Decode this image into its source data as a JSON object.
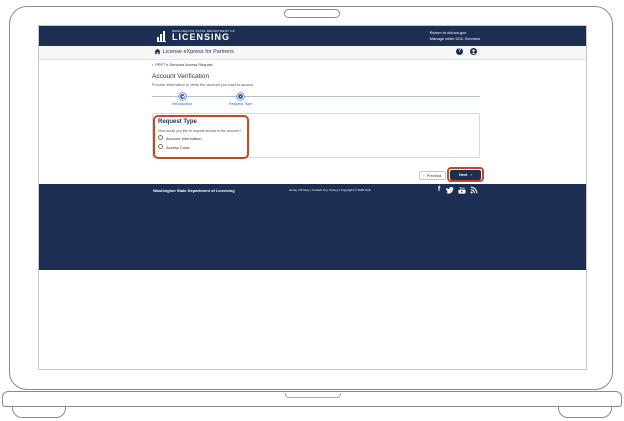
{
  "header": {
    "logo_small": "WASHINGTON STATE DEPARTMENT OF",
    "logo_big": "LICENSING",
    "link_return": "Return to dol.wa.gov",
    "link_manage": "Manage other DOL Services"
  },
  "subnav": {
    "app_title": "License eXpress for Partners",
    "home_icon": "home-icon",
    "help_icon": "question-circle-icon",
    "user_icon": "user-icon"
  },
  "breadcrumb": "PRFT e-Services Access Request",
  "page": {
    "title": "Account Verification",
    "description": "Provide information to verify the account you want to access."
  },
  "stepper": {
    "steps": [
      {
        "label": "Introduction",
        "state": "complete"
      },
      {
        "label": "Request Type",
        "state": "current"
      }
    ]
  },
  "form": {
    "section_title": "Request Type",
    "question": "How would you like to request access to the account?",
    "options": [
      {
        "label": "Account Information",
        "selected": false
      },
      {
        "label": "Access Code",
        "selected": false
      }
    ]
  },
  "buttons": {
    "previous": "Previous",
    "next": "Next"
  },
  "footer": {
    "agency_name": "Washington State Department of Licensing",
    "links": "Home | Privacy | Contact Us | Survey | Copyright © 2025 DOL",
    "social_icons": [
      "facebook-icon",
      "twitter-icon",
      "youtube-icon",
      "rss-icon"
    ]
  },
  "colors": {
    "navy": "#1c2f52",
    "accent_blue": "#2a62c9",
    "highlight_orange": "#c8471f"
  }
}
